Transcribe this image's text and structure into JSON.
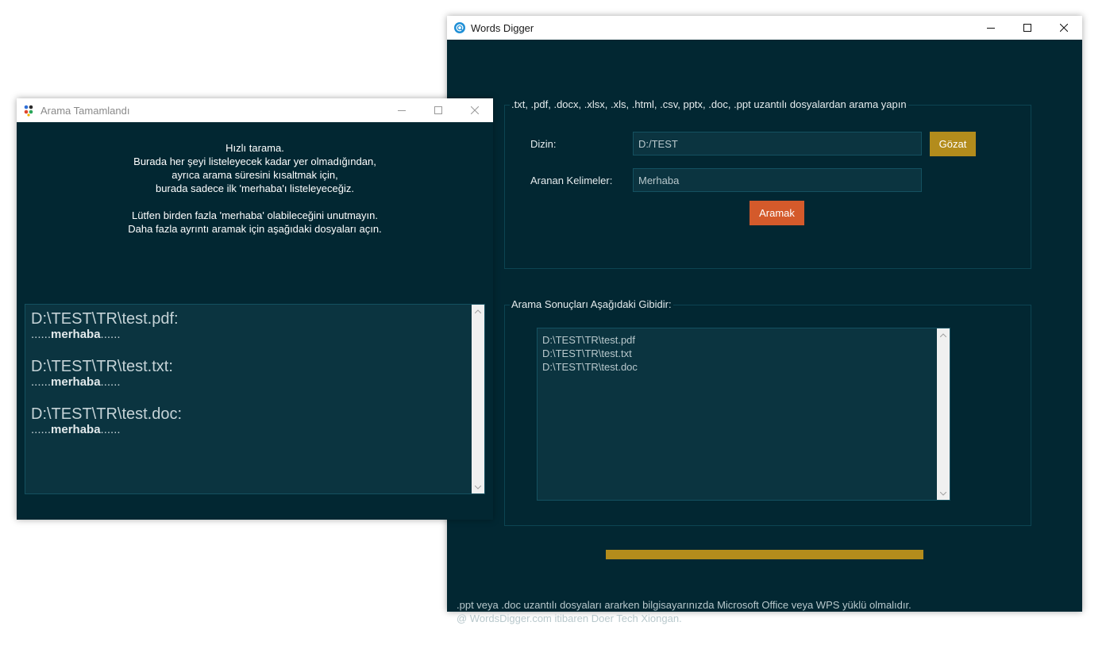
{
  "main_window": {
    "title": "Words Digger",
    "search_group": {
      "legend": ".txt, .pdf, .docx, .xlsx, .xls, .html, .csv, pptx, .doc, .ppt uzantılı dosyalardan arama yapın",
      "directory_label": "Dizin:",
      "directory_value": "D:/TEST",
      "browse_button": "Gözat",
      "keywords_label": "Aranan Kelimeler:",
      "keywords_value": "Merhaba",
      "search_button": "Aramak"
    },
    "results_group": {
      "legend": "Arama Sonuçları Aşağıdaki Gibidir:",
      "items": [
        "D:\\TEST\\TR\\test.pdf",
        "D:\\TEST\\TR\\test.txt",
        "D:\\TEST\\TR\\test.doc"
      ]
    },
    "progress": 1.0,
    "footer": {
      "line1": ".ppt veya .doc uzantılı dosyaları ararken bilgisayarınızda Microsoft Office veya WPS yüklü olmalıdır.",
      "line2": "@ WordsDigger.com itibaren Doer Tech Xiongan."
    },
    "colors": {
      "background": "#022732",
      "browse_button": "#b38c1c",
      "search_button": "#d45a2b",
      "progress_fill": "#b38c1c"
    }
  },
  "done_window": {
    "title": "Arama Tamamlandı",
    "message_lines": [
      "Hızlı tarama.",
      "Burada her şeyi listeleyecek kadar yer olmadığından,",
      "ayrıca arama süresini kısaltmak için,",
      "burada sadece ilk 'merhaba'ı listeleyeceğiz.",
      "",
      "Lütfen birden fazla 'merhaba' olabileceğini unutmayın.",
      "Daha fazla ayrıntı aramak için aşağıdaki dosyaları açın."
    ],
    "entries": [
      {
        "path": "D:\\TEST\\TR\\test.pdf:",
        "prefix": "......",
        "keyword": "merhaba",
        "suffix": "......"
      },
      {
        "path": "D:\\TEST\\TR\\test.txt:",
        "prefix": "......",
        "keyword": "merhaba",
        "suffix": "......"
      },
      {
        "path": "D:\\TEST\\TR\\test.doc:",
        "prefix": "......",
        "keyword": "merhaba",
        "suffix": "......"
      }
    ]
  }
}
